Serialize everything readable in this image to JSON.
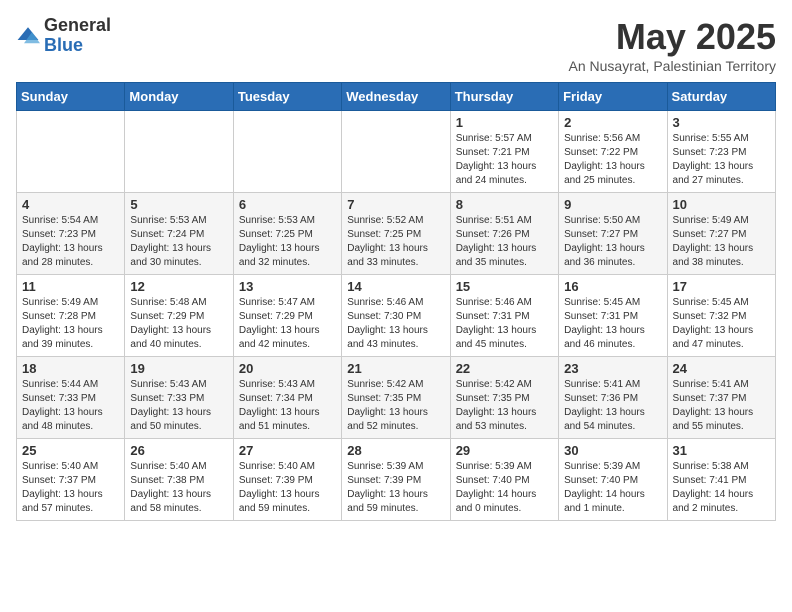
{
  "logo": {
    "general": "General",
    "blue": "Blue"
  },
  "title": "May 2025",
  "subtitle": "An Nusayrat, Palestinian Territory",
  "days_header": [
    "Sunday",
    "Monday",
    "Tuesday",
    "Wednesday",
    "Thursday",
    "Friday",
    "Saturday"
  ],
  "weeks": [
    [
      {
        "day": "",
        "info": ""
      },
      {
        "day": "",
        "info": ""
      },
      {
        "day": "",
        "info": ""
      },
      {
        "day": "",
        "info": ""
      },
      {
        "day": "1",
        "info": "Sunrise: 5:57 AM\nSunset: 7:21 PM\nDaylight: 13 hours\nand 24 minutes."
      },
      {
        "day": "2",
        "info": "Sunrise: 5:56 AM\nSunset: 7:22 PM\nDaylight: 13 hours\nand 25 minutes."
      },
      {
        "day": "3",
        "info": "Sunrise: 5:55 AM\nSunset: 7:23 PM\nDaylight: 13 hours\nand 27 minutes."
      }
    ],
    [
      {
        "day": "4",
        "info": "Sunrise: 5:54 AM\nSunset: 7:23 PM\nDaylight: 13 hours\nand 28 minutes."
      },
      {
        "day": "5",
        "info": "Sunrise: 5:53 AM\nSunset: 7:24 PM\nDaylight: 13 hours\nand 30 minutes."
      },
      {
        "day": "6",
        "info": "Sunrise: 5:53 AM\nSunset: 7:25 PM\nDaylight: 13 hours\nand 32 minutes."
      },
      {
        "day": "7",
        "info": "Sunrise: 5:52 AM\nSunset: 7:25 PM\nDaylight: 13 hours\nand 33 minutes."
      },
      {
        "day": "8",
        "info": "Sunrise: 5:51 AM\nSunset: 7:26 PM\nDaylight: 13 hours\nand 35 minutes."
      },
      {
        "day": "9",
        "info": "Sunrise: 5:50 AM\nSunset: 7:27 PM\nDaylight: 13 hours\nand 36 minutes."
      },
      {
        "day": "10",
        "info": "Sunrise: 5:49 AM\nSunset: 7:27 PM\nDaylight: 13 hours\nand 38 minutes."
      }
    ],
    [
      {
        "day": "11",
        "info": "Sunrise: 5:49 AM\nSunset: 7:28 PM\nDaylight: 13 hours\nand 39 minutes."
      },
      {
        "day": "12",
        "info": "Sunrise: 5:48 AM\nSunset: 7:29 PM\nDaylight: 13 hours\nand 40 minutes."
      },
      {
        "day": "13",
        "info": "Sunrise: 5:47 AM\nSunset: 7:29 PM\nDaylight: 13 hours\nand 42 minutes."
      },
      {
        "day": "14",
        "info": "Sunrise: 5:46 AM\nSunset: 7:30 PM\nDaylight: 13 hours\nand 43 minutes."
      },
      {
        "day": "15",
        "info": "Sunrise: 5:46 AM\nSunset: 7:31 PM\nDaylight: 13 hours\nand 45 minutes."
      },
      {
        "day": "16",
        "info": "Sunrise: 5:45 AM\nSunset: 7:31 PM\nDaylight: 13 hours\nand 46 minutes."
      },
      {
        "day": "17",
        "info": "Sunrise: 5:45 AM\nSunset: 7:32 PM\nDaylight: 13 hours\nand 47 minutes."
      }
    ],
    [
      {
        "day": "18",
        "info": "Sunrise: 5:44 AM\nSunset: 7:33 PM\nDaylight: 13 hours\nand 48 minutes."
      },
      {
        "day": "19",
        "info": "Sunrise: 5:43 AM\nSunset: 7:33 PM\nDaylight: 13 hours\nand 50 minutes."
      },
      {
        "day": "20",
        "info": "Sunrise: 5:43 AM\nSunset: 7:34 PM\nDaylight: 13 hours\nand 51 minutes."
      },
      {
        "day": "21",
        "info": "Sunrise: 5:42 AM\nSunset: 7:35 PM\nDaylight: 13 hours\nand 52 minutes."
      },
      {
        "day": "22",
        "info": "Sunrise: 5:42 AM\nSunset: 7:35 PM\nDaylight: 13 hours\nand 53 minutes."
      },
      {
        "day": "23",
        "info": "Sunrise: 5:41 AM\nSunset: 7:36 PM\nDaylight: 13 hours\nand 54 minutes."
      },
      {
        "day": "24",
        "info": "Sunrise: 5:41 AM\nSunset: 7:37 PM\nDaylight: 13 hours\nand 55 minutes."
      }
    ],
    [
      {
        "day": "25",
        "info": "Sunrise: 5:40 AM\nSunset: 7:37 PM\nDaylight: 13 hours\nand 57 minutes."
      },
      {
        "day": "26",
        "info": "Sunrise: 5:40 AM\nSunset: 7:38 PM\nDaylight: 13 hours\nand 58 minutes."
      },
      {
        "day": "27",
        "info": "Sunrise: 5:40 AM\nSunset: 7:39 PM\nDaylight: 13 hours\nand 59 minutes."
      },
      {
        "day": "28",
        "info": "Sunrise: 5:39 AM\nSunset: 7:39 PM\nDaylight: 13 hours\nand 59 minutes."
      },
      {
        "day": "29",
        "info": "Sunrise: 5:39 AM\nSunset: 7:40 PM\nDaylight: 14 hours\nand 0 minutes."
      },
      {
        "day": "30",
        "info": "Sunrise: 5:39 AM\nSunset: 7:40 PM\nDaylight: 14 hours\nand 1 minute."
      },
      {
        "day": "31",
        "info": "Sunrise: 5:38 AM\nSunset: 7:41 PM\nDaylight: 14 hours\nand 2 minutes."
      }
    ]
  ]
}
